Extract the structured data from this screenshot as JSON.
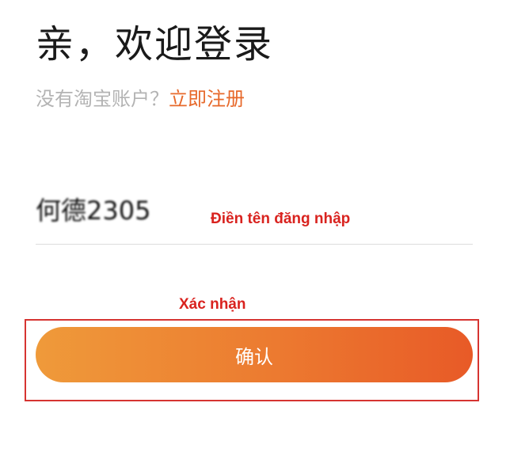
{
  "header": {
    "title": "亲，欢迎登录",
    "no_account_text": "没有淘宝账户？",
    "register_link": "立即注册"
  },
  "form": {
    "username_value": "何德2305"
  },
  "annotations": {
    "username_hint": "Điền tên đăng nhập",
    "confirm_hint": "Xác nhận"
  },
  "actions": {
    "confirm_label": "确认"
  },
  "colors": {
    "accent": "#e7692b",
    "button_gradient_start": "#ef9a3a",
    "button_gradient_end": "#e85a27",
    "annotation_red": "#d9231f"
  }
}
